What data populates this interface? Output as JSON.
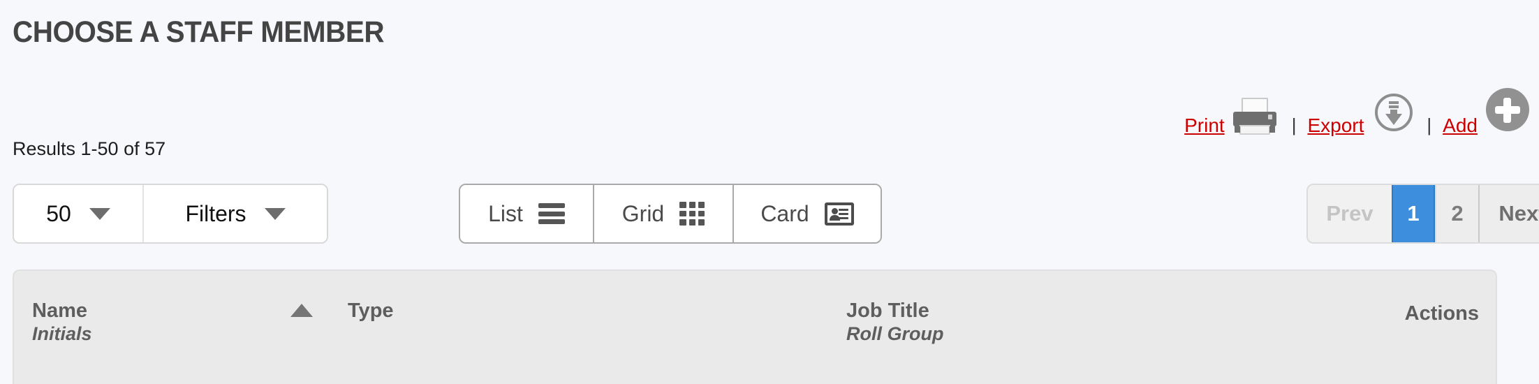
{
  "page": {
    "title": "CHOOSE A STAFF MEMBER",
    "results_text": "Results 1-50 of 57"
  },
  "actions": {
    "print_label": "Print",
    "export_label": "Export",
    "add_label": "Add",
    "separator": "|",
    "print_icon": "printer-icon",
    "export_icon": "download-circle-icon",
    "add_icon": "plus-circle-icon"
  },
  "toolbar": {
    "page_size": {
      "value": "50",
      "caret_icon": "chevron-down-icon"
    },
    "filters": {
      "label": "Filters",
      "caret_icon": "chevron-down-icon"
    },
    "views": [
      {
        "label": "List",
        "icon": "hamburger-icon",
        "selected": true
      },
      {
        "label": "Grid",
        "icon": "grid-icon",
        "selected": false
      },
      {
        "label": "Card",
        "icon": "id-card-icon",
        "selected": false
      }
    ]
  },
  "pagination": {
    "prev_label": "Prev",
    "next_label": "Next",
    "pages": [
      "1",
      "2"
    ],
    "current_page": "1",
    "active_color": "#3d8fdd"
  },
  "table": {
    "columns": [
      {
        "main": "Name",
        "sub": "Initials",
        "sorted": "asc"
      },
      {
        "main": "Type",
        "sub": ""
      },
      {
        "main": "Job Title",
        "sub": "Roll Group"
      },
      {
        "main": "Actions",
        "sub": ""
      }
    ]
  },
  "colors": {
    "link_red": "#cc0000",
    "background": "#f7f8fc",
    "table_header_bg": "#eaeaea",
    "title_gray": "#444444"
  }
}
